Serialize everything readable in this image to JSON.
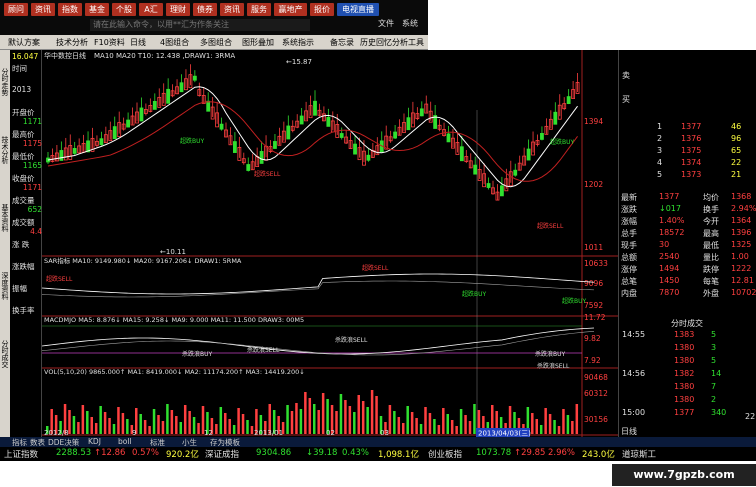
{
  "topbar": {
    "buttons": [
      "顾问",
      "资讯",
      "指数",
      "基金",
      "个股",
      "A汇",
      "理财",
      "债券",
      "资讯",
      "服务",
      "赢地产",
      "报价",
      "电视直播"
    ],
    "command_placeholder": "请在此输入命令，以用**汇为作条关注"
  },
  "menus": [
    "文件",
    "系统"
  ],
  "toolbar": [
    "默认方案",
    "技术分析",
    "F10资料",
    "日线",
    "4图组合",
    "多图组合",
    "图形叠加",
    "系统指示",
    "备忘录",
    "历史回忆",
    "分析工具"
  ],
  "chart": {
    "stock_name": "华中数控日线",
    "ma_header": "MA10 MA20  T10: 12.438  ,DRAW1: 3RMA",
    "high_label": "15.87",
    "low_label": "10.11",
    "sar_header": "SAR指标  MA10: 9149.980↓  MA20: 9167.206↓  DRAW1: 5RMA",
    "macd_header": "MACDMJO MA5: 8.876↓ MA15: 9.258↓ MA9: 9.000  MA11: 11.500  DRAW3: 00M5",
    "vol_header": "VOL(5,10,20)  9865.000↑  MA1: 8419.000↓  MA2: 11174.200↑  MA3: 14419.200↓",
    "date_label": "2013/04/03(三)",
    "tab_label": "日线",
    "signals": {
      "buy": "超跌BUY",
      "sell": "超跌SELL",
      "macd_buy": "杀跌浪BUY",
      "macd_sell": "杀跌浪SELL"
    },
    "price_axis": [
      "1394",
      "1202",
      "1011",
      "10633",
      "9096",
      "7592",
      "11.72",
      "9.82",
      "7.92",
      "90468",
      "60312",
      "30156"
    ],
    "x_labels": [
      "2012/8",
      "9",
      "12",
      "2013/01",
      "02",
      "03"
    ]
  },
  "leftpanel": {
    "code": "16.047",
    "labels": [
      "时间",
      "2013",
      "开盘价",
      "最高价",
      "最低价",
      "收盘价",
      "成交量",
      "成交额",
      "涨 跌",
      "涨跌幅",
      "振幅",
      "换手率"
    ],
    "values": [
      "",
      "",
      "1171",
      "1175",
      "1165",
      "1171",
      "652",
      "4.4",
      "",
      "",
      "",
      ""
    ]
  },
  "vtabs": [
    "分时走势",
    "技术分析",
    "基本资料",
    "深度资料",
    "分时成交"
  ],
  "rightpanel": {
    "sell_label": "卖",
    "buy_label": "买",
    "order_rows": [
      [
        "1",
        "1377",
        "46"
      ],
      [
        "2",
        "1376",
        "96"
      ],
      [
        "3",
        "1375",
        "65"
      ],
      [
        "4",
        "1374",
        "22"
      ],
      [
        "5",
        "1373",
        "21"
      ]
    ],
    "stats": [
      [
        "最新",
        "1377",
        "均价",
        "1368"
      ],
      [
        "涨跌",
        "↓017",
        "换手",
        "2.94%"
      ],
      [
        "涨幅",
        "1.40%",
        "今开",
        "1364"
      ],
      [
        "总手",
        "18572",
        "最高",
        "1396"
      ],
      [
        "现手",
        "30",
        "最低",
        "1325"
      ],
      [
        "总额",
        "2540",
        "量比",
        "1.00"
      ],
      [
        "涨停",
        "1494",
        "跌停",
        "1222"
      ],
      [
        "总笔",
        "1450",
        "每笔",
        "12.81"
      ],
      [
        "内盘",
        "7870",
        "外盘",
        "10702"
      ]
    ],
    "ticks_title": "分时成交",
    "ticks": [
      [
        "14:55",
        "1383",
        "5"
      ],
      [
        "",
        "1380",
        "3"
      ],
      [
        "",
        "1380",
        "5"
      ],
      [
        "14:56",
        "1382",
        "14"
      ],
      [
        "",
        "1380",
        "7"
      ],
      [
        "",
        "1380",
        "2"
      ],
      [
        "15:00",
        "1377",
        "340"
      ]
    ],
    "tick_tail": "22",
    "bottom_label": "日线"
  },
  "bottomtabs": [
    "指标",
    "数表",
    "DDE决策",
    "KDJ",
    "boll",
    "标准",
    "小生",
    "存为模板"
  ],
  "ticker": [
    {
      "t": "上证指数",
      "c": "#e0e0e0"
    },
    {
      "t": "2288.53",
      "c": "#30e030"
    },
    {
      "t": "↑12.86",
      "c": "#ff4040"
    },
    {
      "t": "0.57%",
      "c": "#ff4040"
    },
    {
      "t": "920.2亿",
      "c": "#ffff40"
    },
    {
      "t": "深证成指",
      "c": "#e0e0e0"
    },
    {
      "t": "9304.86",
      "c": "#30e030"
    },
    {
      "t": "↓39.18",
      "c": "#30e030"
    },
    {
      "t": "0.43%",
      "c": "#30e030"
    },
    {
      "t": "1,098.1亿",
      "c": "#ffff40"
    },
    {
      "t": "创业板指",
      "c": "#e0e0e0"
    },
    {
      "t": "1073.78",
      "c": "#30e030"
    },
    {
      "t": "↑29.85",
      "c": "#ff4040"
    },
    {
      "t": "2.96%",
      "c": "#ff4040"
    },
    {
      "t": "243.0亿",
      "c": "#ffff40"
    },
    {
      "t": "道琼斯工",
      "c": "#e0e0e0"
    }
  ],
  "watermark": "www.7gpzb.com",
  "colors": {
    "up": "#ff4040",
    "down": "#30e030",
    "ma_white": "#ffffff",
    "ma_red": "#c02020",
    "accent": "#b03020"
  }
}
